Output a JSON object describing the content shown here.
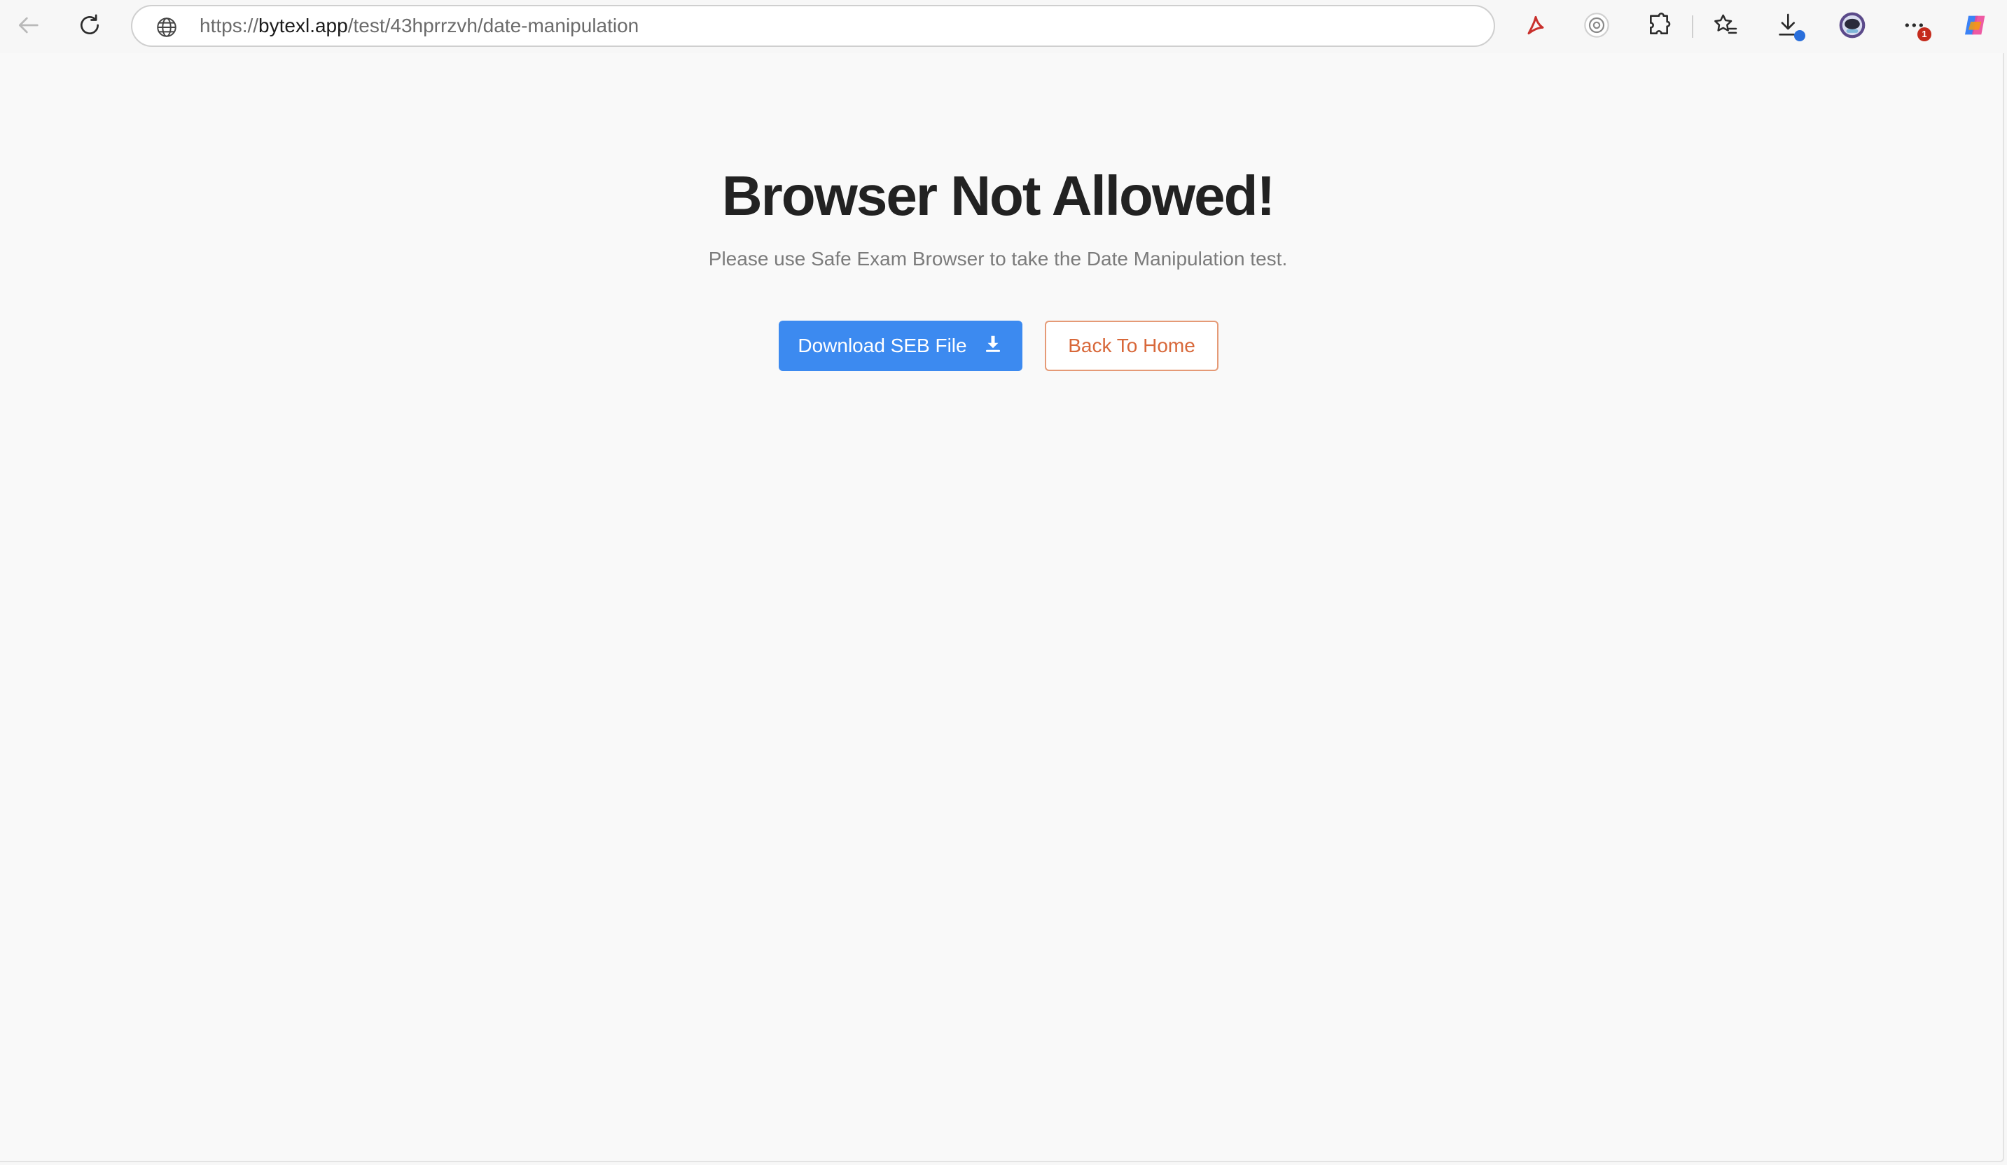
{
  "browser": {
    "url_scheme": "https://",
    "url_host": "bytexl.app",
    "url_path": "/test/43hprrzvh/date-manipulation",
    "icons": [
      "back-icon",
      "reload-icon",
      "globe-icon",
      "pdf-icon",
      "browser-essentials-icon",
      "extensions-icon",
      "favorites-icon",
      "downloads-icon",
      "profile-icon",
      "more-icon",
      "copilot-icon"
    ],
    "more_badge": "1",
    "accent_colors": {
      "downloads_badge": "#2a6fdb",
      "more_badge": "#c42b1c"
    }
  },
  "page": {
    "title": "Browser Not Allowed!",
    "subtitle": "Please use Safe Exam Browser to take the Date Manipulation test.",
    "download_button_label": "Download SEB File",
    "download_icon": "download-icon",
    "home_button_label": "Back To Home",
    "colors": {
      "primary": "#3c8af0",
      "secondary_text": "#d8683a",
      "secondary_border": "#e59a76",
      "title": "#222222",
      "subtitle": "#7b7b7b",
      "background": "#f9f9f9"
    }
  }
}
